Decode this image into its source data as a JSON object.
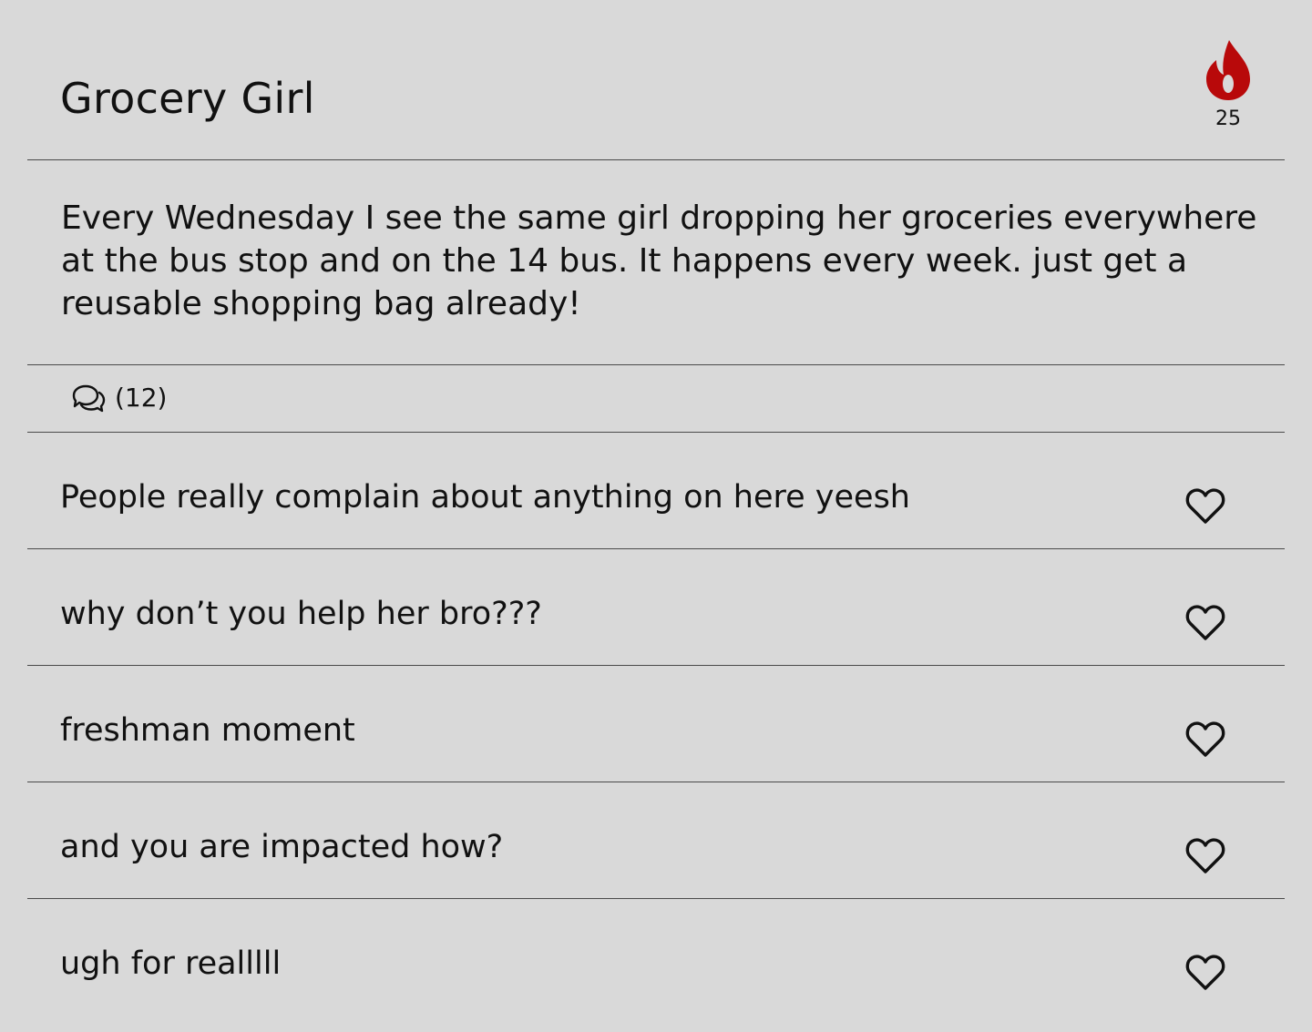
{
  "post": {
    "title": "Grocery Girl",
    "fire_count": "25",
    "fire_icon": "fire-icon",
    "fire_color": "#b8090a",
    "body": "Every Wednesday I see the same girl dropping her groceries everywhere at the bus stop and on the 14 bus. It happens every week. just get a reusable shopping bag already!"
  },
  "comments_bar": {
    "icon": "comments-icon",
    "count_text": "(12)"
  },
  "comments": [
    {
      "text": "People really complain about anything on here yeesh",
      "icon": "heart-icon"
    },
    {
      "text": "why don’t you help her bro???",
      "icon": "heart-icon"
    },
    {
      "text": "freshman moment",
      "icon": "heart-icon"
    },
    {
      "text": "and you are impacted how?",
      "icon": "heart-icon"
    },
    {
      "text": "ugh for realllll",
      "icon": "heart-icon"
    }
  ],
  "colors": {
    "background": "#d9d9d9",
    "divider": "#4a4a4a",
    "text": "#111111"
  }
}
